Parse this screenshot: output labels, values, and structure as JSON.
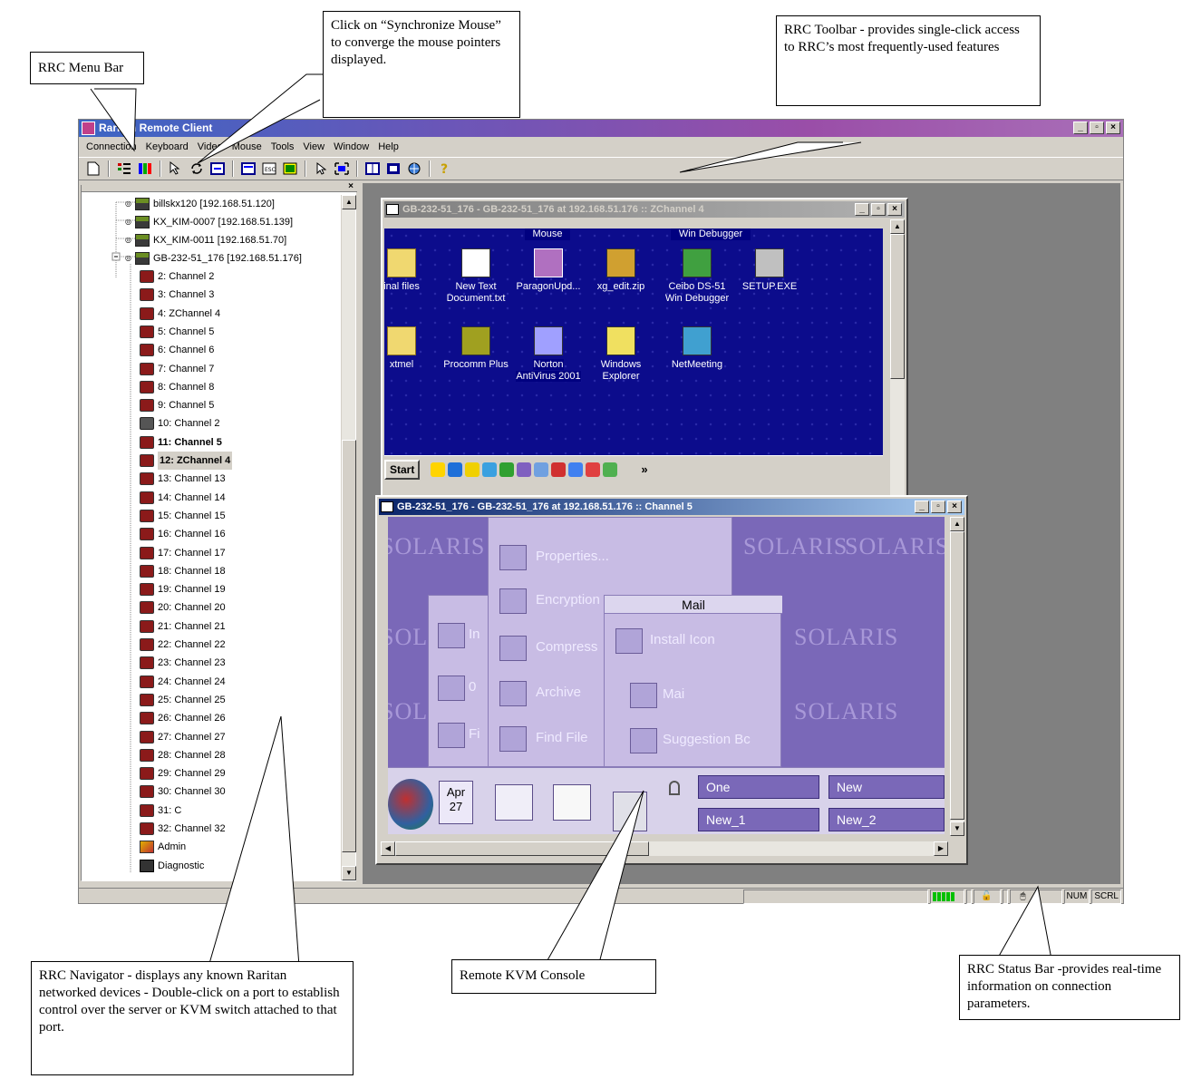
{
  "callouts": {
    "menu_bar": "RRC Menu Bar",
    "sync_mouse": "Click on “Synchronize Mouse” to converge the mouse pointers displayed.",
    "toolbar": "RRC Toolbar - provides single-click access to RRC’s most frequently-used features",
    "navigator": "RRC Navigator - displays any known Raritan networked devices - Double-click on a port to establish control over the server or KVM switch attached to that port.",
    "kvm_console": "Remote KVM Console",
    "status_bar": "RRC Status Bar -provides real-time information on connection parameters."
  },
  "window": {
    "title": "Raritan Remote Client",
    "min": "_",
    "max": "▫",
    "close": "×"
  },
  "menu": [
    "Connection",
    "Keyboard",
    "Video",
    "Mouse",
    "Tools",
    "View",
    "Window",
    "Help"
  ],
  "toolbar_icons": [
    "new-connection-icon",
    "properties-icon",
    "color-icon",
    "sync-mouse-icon",
    "refresh-icon",
    "auto-sense-icon",
    "keyboard-macro-icon",
    "esc-icon",
    "ctrl-alt-del-icon",
    "pointer-icon",
    "fullscreen-icon",
    "tile-icon",
    "cascade-icon",
    "connection-icon",
    "help-icon"
  ],
  "navigator": {
    "close": "×",
    "devices": [
      "billskx120 [192.168.51.120]",
      "KX_KIM-0007 [192.168.51.139]",
      "KX_KIM-0011 [192.168.51.70]",
      "GB-232-51_176 [192.168.51.176]"
    ],
    "ports": [
      "2: Channel 2",
      "3: Channel 3",
      "4: ZChannel 4",
      "5: Channel 5",
      "6: Channel 6",
      "7: Channel 7",
      "8: Channel 8",
      "9: Channel 5",
      "10: Channel 2",
      "11: Channel 5",
      "12: ZChannel 4",
      "13: Channel 13",
      "14: Channel 14",
      "15: Channel 15",
      "16: Channel 16",
      "17: Channel 17",
      "18: Channel 18",
      "19: Channel 19",
      "20: Channel 20",
      "21: Channel 21",
      "22: Channel 22",
      "23: Channel 23",
      "24: Channel 24",
      "25: Channel 25",
      "26: Channel 26",
      "27: Channel 27",
      "28: Channel 28",
      "29: Channel 29",
      "30: Channel 30",
      "31: C",
      "32: Channel 32",
      "Admin",
      "Diagnostic"
    ]
  },
  "console1": {
    "title": "GB-232-51_176 - GB-232-51_176 at 192.168.51.176 :: ZChannel 4",
    "top_labels": [
      "Mouse",
      "Win Debugger"
    ],
    "icons_row1": [
      "inal files",
      "New Text Document.txt",
      "ParagonUpd...",
      "xg_edit.zip",
      "Ceibo DS-51 Win Debugger",
      "SETUP.EXE"
    ],
    "icons_row2": [
      "xtmel",
      "Procomm Plus",
      "Norton AntiVirus 2001",
      "Windows Explorer",
      "NetMeeting"
    ],
    "start": "Start",
    "more": "»"
  },
  "console2": {
    "title": "GB-232-51_176 - GB-232-51_176 at 192.168.51.176 :: Channel 5",
    "watermark": "SOLARIS",
    "menu_items": [
      "Properties...",
      "Encryption",
      "Compress",
      "Archive",
      "Find File"
    ],
    "mail_title": "Mail",
    "mail_items": [
      "Install Icon",
      "Mai",
      "Suggestion Bc"
    ],
    "left_items": [
      "In",
      "0",
      "Fi"
    ],
    "date_month": "Apr",
    "date_day": "27",
    "workspaces": [
      "One",
      "New",
      "New_1",
      "New_2"
    ]
  },
  "statusbar": {
    "num": "NUM",
    "scrl": "SCRL"
  }
}
